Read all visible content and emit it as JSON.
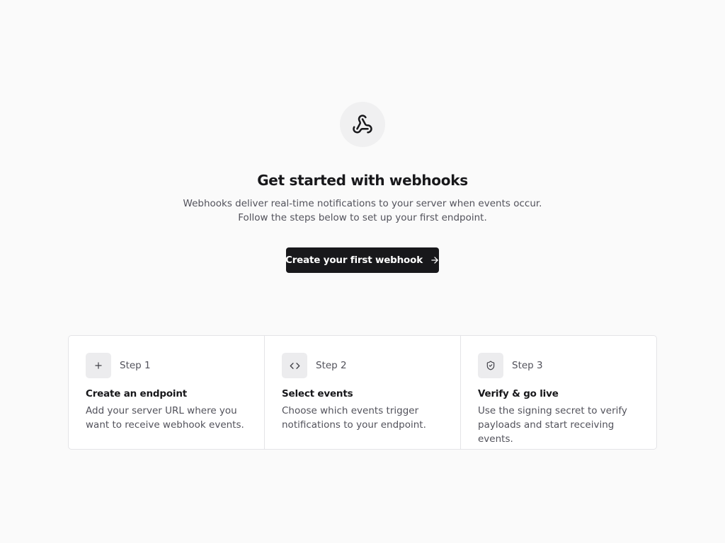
{
  "hero": {
    "icon": "webhook-icon",
    "title": "Get started with webhooks",
    "description": "Webhooks deliver real-time notifications to your server when events occur. Follow the steps below to set up your first endpoint.",
    "cta_label": "Create your first webhook",
    "cta_icon": "arrow-right-icon"
  },
  "steps": [
    {
      "icon": "plus-icon",
      "label": "Step 1",
      "title": "Create an endpoint",
      "description": "Add your server URL where you want to receive webhook events."
    },
    {
      "icon": "code-icon",
      "label": "Step 2",
      "title": "Select events",
      "description": "Choose which events trigger notifications to your endpoint."
    },
    {
      "icon": "shield-check-icon",
      "label": "Step 3",
      "title": "Verify & go live",
      "description": "Use the signing secret to verify payloads and start receiving events."
    }
  ],
  "colors": {
    "background": "#fafafa",
    "primary_button": "#18181b",
    "card_border": "#e4e4e7",
    "icon_tile": "#ececee"
  }
}
